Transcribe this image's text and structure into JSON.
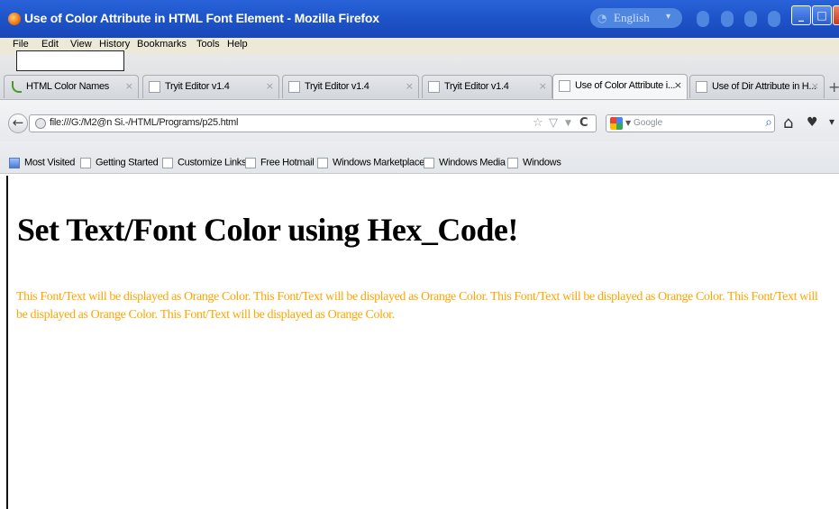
{
  "window": {
    "title": "Use of Color Attribute in HTML Font Element - Mozilla Firefox",
    "language_pill": "English",
    "language_arrow": "▾",
    "minimize": "_",
    "maximize": "□",
    "close": "X"
  },
  "menu": {
    "items": [
      "File",
      "Edit",
      "View",
      "History",
      "Bookmarks",
      "Tools",
      "Help"
    ]
  },
  "tabs": [
    {
      "label": "HTML Color Names",
      "active": false
    },
    {
      "label": "Tryit Editor v1.4",
      "active": false
    },
    {
      "label": "Tryit Editor v1.4",
      "active": false
    },
    {
      "label": "Tryit Editor v1.4",
      "active": false
    },
    {
      "label": "Use of Color Attribute i...",
      "active": true
    },
    {
      "label": "Use of Dir Attribute in H...",
      "active": false
    }
  ],
  "tab_close_glyph": "×",
  "new_tab_glyph": "+",
  "navbar": {
    "back_glyph": "←",
    "url": "file:///G:/M2@n Si.-/HTML/Programs/p25.html",
    "star_glyph": "☆",
    "reload_glyph": "C",
    "search_placeholder": "Google",
    "search_glyph": "⌕",
    "home_glyph": "⌂",
    "pocket_glyph": "♥",
    "more_glyph": "▾"
  },
  "bookmarks": [
    "Most Visited",
    "Getting Started",
    "Customize Links",
    "Free Hotmail",
    "Windows Marketplace",
    "Windows Media",
    "Windows"
  ],
  "page": {
    "heading": "Set Text/Font Color using Hex_Code!",
    "body_text": "This Font/Text will be displayed as Orange Color. This Font/Text will be displayed as Orange Color. This Font/Text will be displayed as Orange Color. This Font/Text will be displayed as Orange Color. This Font/Text will be displayed as Orange Color.",
    "text_color": "#ffa500"
  },
  "colors": {
    "titlebar": "#1f56cc",
    "orange": "#ffa500"
  }
}
